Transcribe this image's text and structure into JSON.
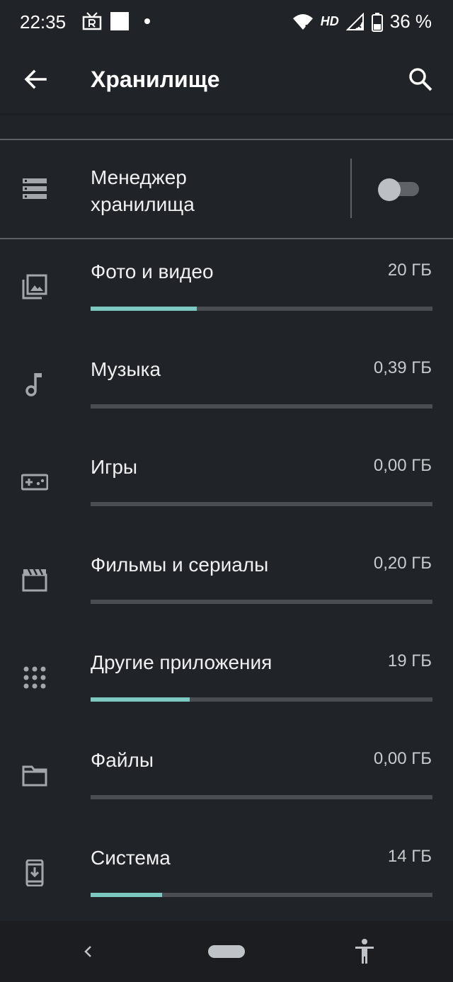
{
  "status_bar": {
    "time": "22:35",
    "network_badge": "HD",
    "battery": "36 %",
    "icons": [
      "tv-icon",
      "notification-square",
      "dot",
      "wifi-icon",
      "signal-icon",
      "battery-icon"
    ]
  },
  "app_bar": {
    "title": "Хранилище",
    "back_icon": "arrow-back-icon",
    "search_icon": "search-icon"
  },
  "storage_manager": {
    "label": "Менеджер хранилища",
    "toggle_on": false
  },
  "categories": [
    {
      "label": "Фото и видео",
      "size": "20 ГБ",
      "fill": 0.31,
      "icon": "photo-icon"
    },
    {
      "label": "Музыка",
      "size": "0,39 ГБ",
      "fill": 0,
      "icon": "music-note-icon"
    },
    {
      "label": "Игры",
      "size": "0,00 ГБ",
      "fill": 0,
      "icon": "gamepad-icon"
    },
    {
      "label": "Фильмы и сериалы",
      "size": "0,20 ГБ",
      "fill": 0,
      "icon": "movie-clapper-icon"
    },
    {
      "label": "Другие приложения",
      "size": "19 ГБ",
      "fill": 0.29,
      "icon": "apps-grid-icon"
    },
    {
      "label": "Файлы",
      "size": "0,00 ГБ",
      "fill": 0,
      "icon": "folder-icon"
    },
    {
      "label": "Система",
      "size": "14 ГБ",
      "fill": 0.21,
      "icon": "system-update-icon"
    }
  ],
  "colors": {
    "background": "#202327",
    "accent": "#7cc9c1",
    "track": "#4a4e53"
  }
}
